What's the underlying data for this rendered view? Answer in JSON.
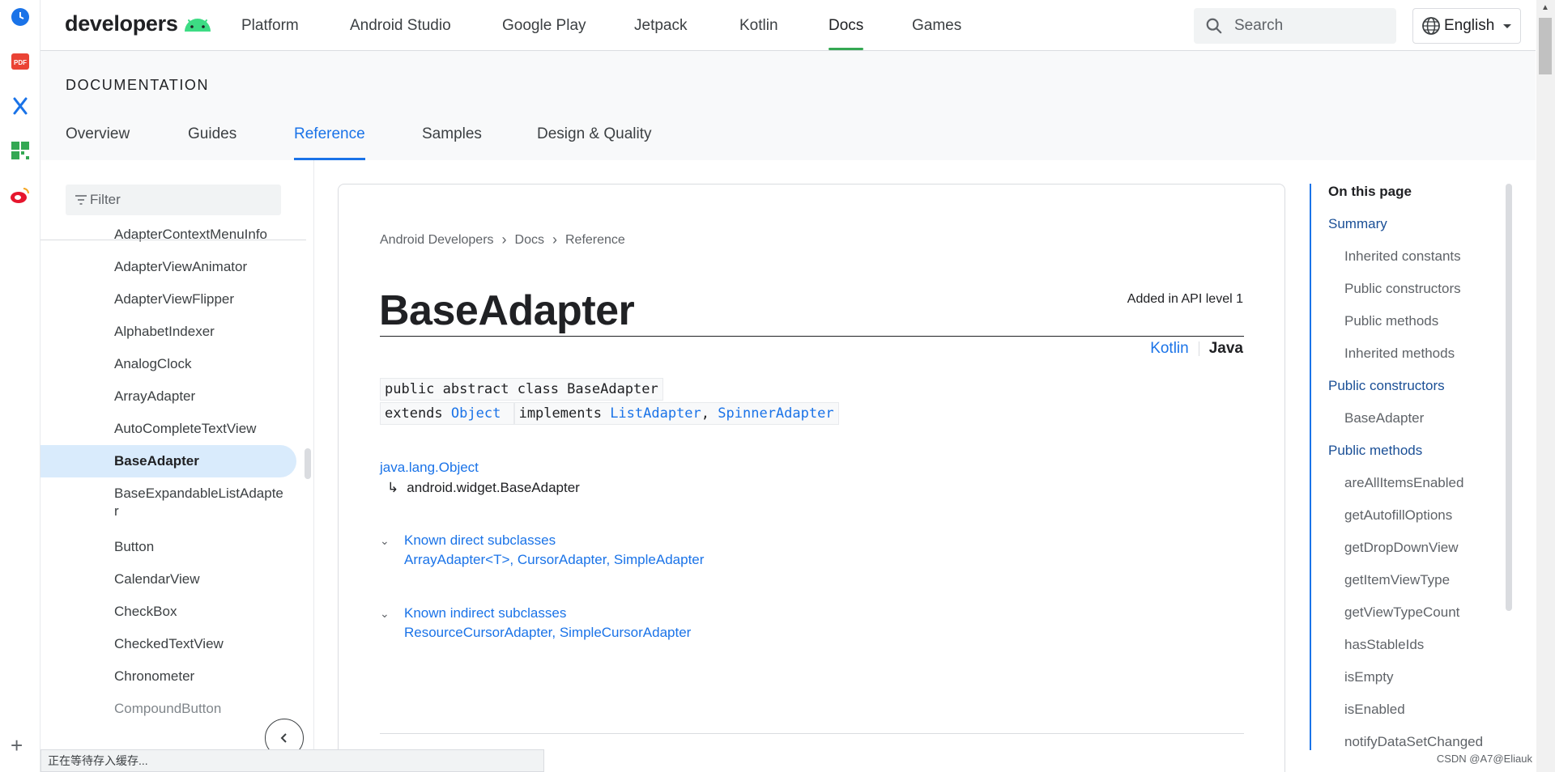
{
  "browser_strip": {
    "icons": [
      "clock-icon",
      "pdf-icon",
      "xmind-icon",
      "apps-grid-icon",
      "weibo-icon"
    ],
    "pdf_text": "PDF"
  },
  "header": {
    "logo_text": "developers",
    "nav": [
      "Platform",
      "Android Studio",
      "Google Play",
      "Jetpack",
      "Kotlin",
      "Docs",
      "Games"
    ],
    "active_nav": "Docs",
    "search_placeholder": "Search",
    "language": "English"
  },
  "doc_header": {
    "title": "DOCUMENTATION",
    "tabs": [
      "Overview",
      "Guides",
      "Reference",
      "Samples",
      "Design & Quality"
    ],
    "active_tab": "Reference"
  },
  "leftnav": {
    "filter_placeholder": "Filter",
    "items": [
      "AdapterContextMenuInfo",
      "AdapterViewAnimator",
      "AdapterViewFlipper",
      "AlphabetIndexer",
      "AnalogClock",
      "ArrayAdapter",
      "AutoCompleteTextView",
      "BaseAdapter",
      "BaseExpandableListAdapter",
      "Button",
      "CalendarView",
      "CheckBox",
      "CheckedTextView",
      "Chronometer",
      "CompoundButton"
    ],
    "selected": "BaseAdapter"
  },
  "main": {
    "breadcrumb": [
      "Android Developers",
      "Docs",
      "Reference"
    ],
    "title": "BaseAdapter",
    "added_in": "Added in API level 1",
    "lang_kotlin": "Kotlin",
    "lang_java": "Java",
    "signature_line1": "public abstract class BaseAdapter",
    "signature_extends_kw": "extends",
    "signature_extends": "Object",
    "signature_implements_kw": "implements",
    "signature_impl1": "ListAdapter",
    "signature_impl_sep": ",",
    "signature_impl2": "SpinnerAdapter",
    "inheritance_root": "java.lang.Object",
    "inheritance_arrow": "↳",
    "inheritance_child": "android.widget.BaseAdapter",
    "direct_subclasses_label": "Known direct subclasses",
    "direct_subclasses": "ArrayAdapter<T>, CursorAdapter, SimpleAdapter",
    "indirect_subclasses_label": "Known indirect subclasses",
    "indirect_subclasses": "ResourceCursorAdapter, SimpleCursorAdapter"
  },
  "toc": {
    "heading": "On this page",
    "items": [
      {
        "label": "Summary",
        "level": 1
      },
      {
        "label": "Inherited constants",
        "level": 2
      },
      {
        "label": "Public constructors",
        "level": 2
      },
      {
        "label": "Public methods",
        "level": 2
      },
      {
        "label": "Inherited methods",
        "level": 2
      },
      {
        "label": "Public constructors",
        "level": 1
      },
      {
        "label": "BaseAdapter",
        "level": 2
      },
      {
        "label": "Public methods",
        "level": 1
      },
      {
        "label": "areAllItemsEnabled",
        "level": 2
      },
      {
        "label": "getAutofillOptions",
        "level": 2
      },
      {
        "label": "getDropDownView",
        "level": 2
      },
      {
        "label": "getItemViewType",
        "level": 2
      },
      {
        "label": "getViewTypeCount",
        "level": 2
      },
      {
        "label": "hasStableIds",
        "level": 2
      },
      {
        "label": "isEmpty",
        "level": 2
      },
      {
        "label": "isEnabled",
        "level": 2
      },
      {
        "label": "notifyDataSetChanged",
        "level": 2
      }
    ]
  },
  "statusbar": {
    "text": "正在等待存入缓存..."
  },
  "watermark": "CSDN @A7@Eliauk",
  "colors": {
    "accent_blue": "#1a73e8",
    "android_green": "#3ddc84",
    "active_underline_green": "#34a853",
    "selected_bg": "#d9ebfc"
  }
}
